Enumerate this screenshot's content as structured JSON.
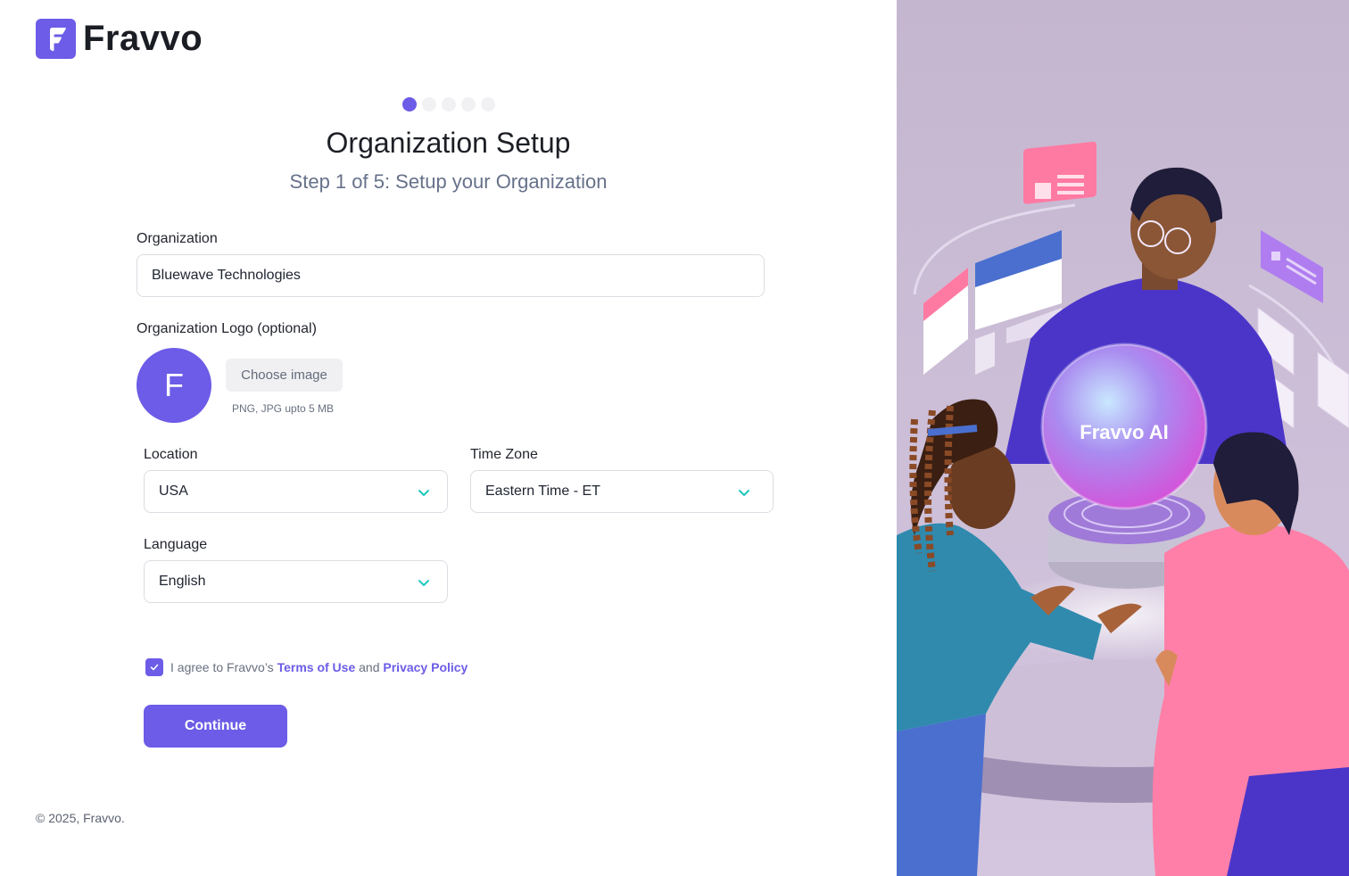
{
  "brand": {
    "name": "Fravvo",
    "accent": "#6c5ce7"
  },
  "stepper": {
    "total": 5,
    "current": 1
  },
  "header": {
    "title": "Organization Setup",
    "subtitle": "Step 1 of 5: Setup your Organization"
  },
  "form": {
    "organization": {
      "label": "Organization",
      "value": "Bluewave Technologies"
    },
    "logo": {
      "label": "Organization Logo (optional)",
      "avatar_letter": "F",
      "choose_label": "Choose image",
      "hint": "PNG, JPG upto 5 MB"
    },
    "location": {
      "label": "Location",
      "value": "USA"
    },
    "timezone": {
      "label": "Time Zone",
      "value": "Eastern Time - ET"
    },
    "language": {
      "label": "Language",
      "value": "English"
    },
    "agree": {
      "checked": true,
      "prefix": "I agree to Fravvo’s",
      "terms": "Terms of Use",
      "and": "and",
      "privacy": "Privacy Policy"
    },
    "continue_label": "Continue"
  },
  "footer": {
    "copyright": "© 2025, Fravvo."
  },
  "illustration": {
    "orb_label": "Fravvo AI"
  }
}
